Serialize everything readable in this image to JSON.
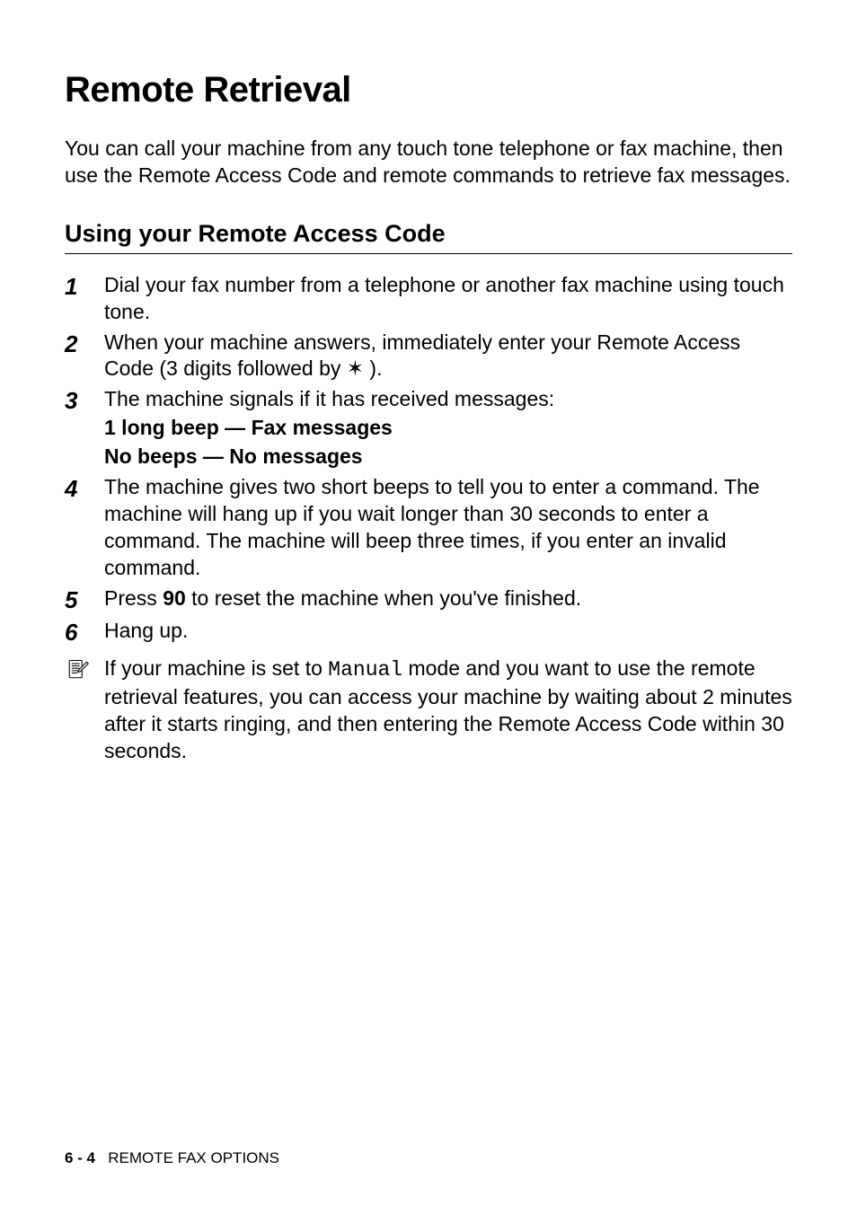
{
  "title": "Remote Retrieval",
  "intro": "You can call your machine from any touch tone telephone or fax machine, then use the Remote Access Code and remote commands to retrieve fax messages.",
  "section_heading": "Using your Remote Access Code",
  "steps": [
    {
      "num": "1",
      "text": "Dial your fax number from a telephone or another fax machine using touch tone."
    },
    {
      "num": "2",
      "text_pre": "When your machine answers, immediately enter your Remote Access Code (3 digits followed by ",
      "star": "✶",
      "text_post": " )."
    },
    {
      "num": "3",
      "text": "The machine signals if it has received messages:",
      "sub1": "1 long beep — Fax messages",
      "sub2": "No beeps — No messages"
    },
    {
      "num": "4",
      "text": "The machine gives two short beeps to tell you to enter a command. The machine will hang up if you wait longer than 30 seconds to enter a command. The machine will beep three times, if you enter an invalid command."
    },
    {
      "num": "5",
      "text_pre": "Press ",
      "bold": "90",
      "text_post": " to reset the machine when you've finished."
    },
    {
      "num": "6",
      "text": "Hang up."
    }
  ],
  "note": {
    "pre": "If your machine is set to ",
    "code": "Manual",
    "post": " mode and you want to use the remote retrieval features, you can access your machine by waiting about 2 minutes after it starts ringing, and then entering the Remote Access Code within 30 seconds."
  },
  "footer": {
    "page": "6 - 4",
    "label": "REMOTE FAX OPTIONS"
  }
}
